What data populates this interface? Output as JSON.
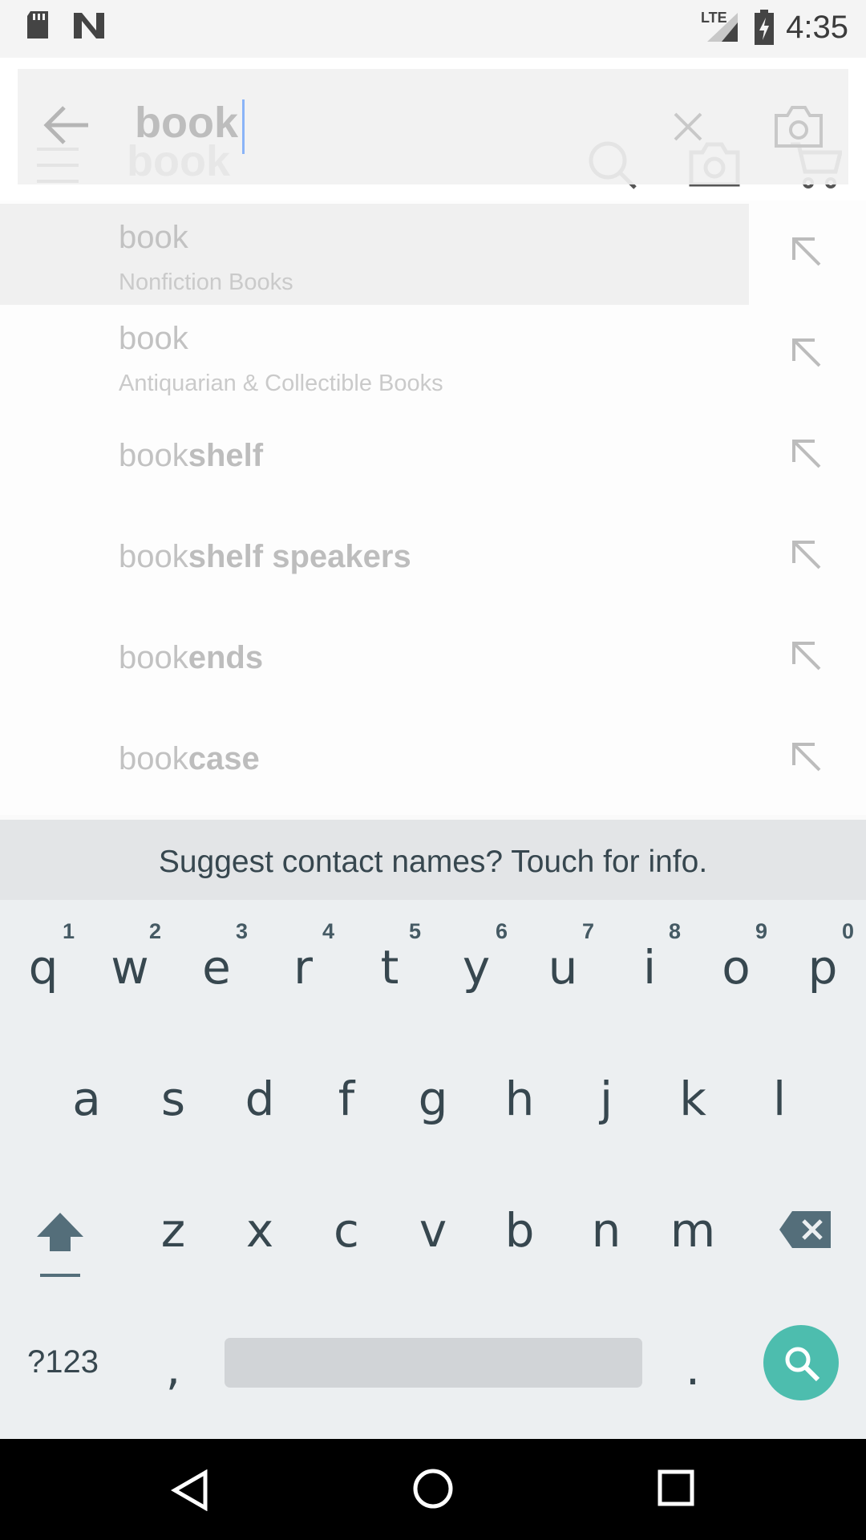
{
  "status_bar": {
    "time": "4:35",
    "network": "LTE"
  },
  "app_header": {
    "query": "book"
  },
  "search": {
    "value": "book"
  },
  "suggestions": [
    {
      "prefix": "book",
      "suffix": "",
      "category": "Nonfiction Books"
    },
    {
      "prefix": "book",
      "suffix": "",
      "category": "Antiquarian & Collectible Books"
    },
    {
      "prefix": "book",
      "suffix": "shelf",
      "category": ""
    },
    {
      "prefix": "book",
      "suffix": "shelf speakers",
      "category": ""
    },
    {
      "prefix": "book",
      "suffix": "ends",
      "category": ""
    },
    {
      "prefix": "book",
      "suffix": "case",
      "category": ""
    }
  ],
  "keyboard": {
    "hint": "Suggest contact names? Touch for info.",
    "row1": [
      "q",
      "w",
      "e",
      "r",
      "t",
      "y",
      "u",
      "i",
      "o",
      "p"
    ],
    "row1_hints": [
      "1",
      "2",
      "3",
      "4",
      "5",
      "6",
      "7",
      "8",
      "9",
      "0"
    ],
    "row2": [
      "a",
      "s",
      "d",
      "f",
      "g",
      "h",
      "j",
      "k",
      "l"
    ],
    "row3": [
      "z",
      "x",
      "c",
      "v",
      "b",
      "n",
      "m"
    ],
    "symbols": "?123",
    "comma": ",",
    "period": "."
  },
  "colors": {
    "enter_key": "#4dbdae",
    "caret": "#8ab4f8",
    "nav_bar": "#000000"
  },
  "icons": [
    "sd-card-icon",
    "n-logo-icon",
    "signal-icon",
    "battery-icon",
    "back-arrow-icon",
    "menu-icon",
    "clear-icon",
    "camera-icon",
    "search-icon",
    "cart-icon",
    "suggestion-fill-arrow-icon",
    "shift-icon",
    "backspace-icon",
    "nav-back-icon",
    "nav-home-icon",
    "nav-recents-icon"
  ]
}
